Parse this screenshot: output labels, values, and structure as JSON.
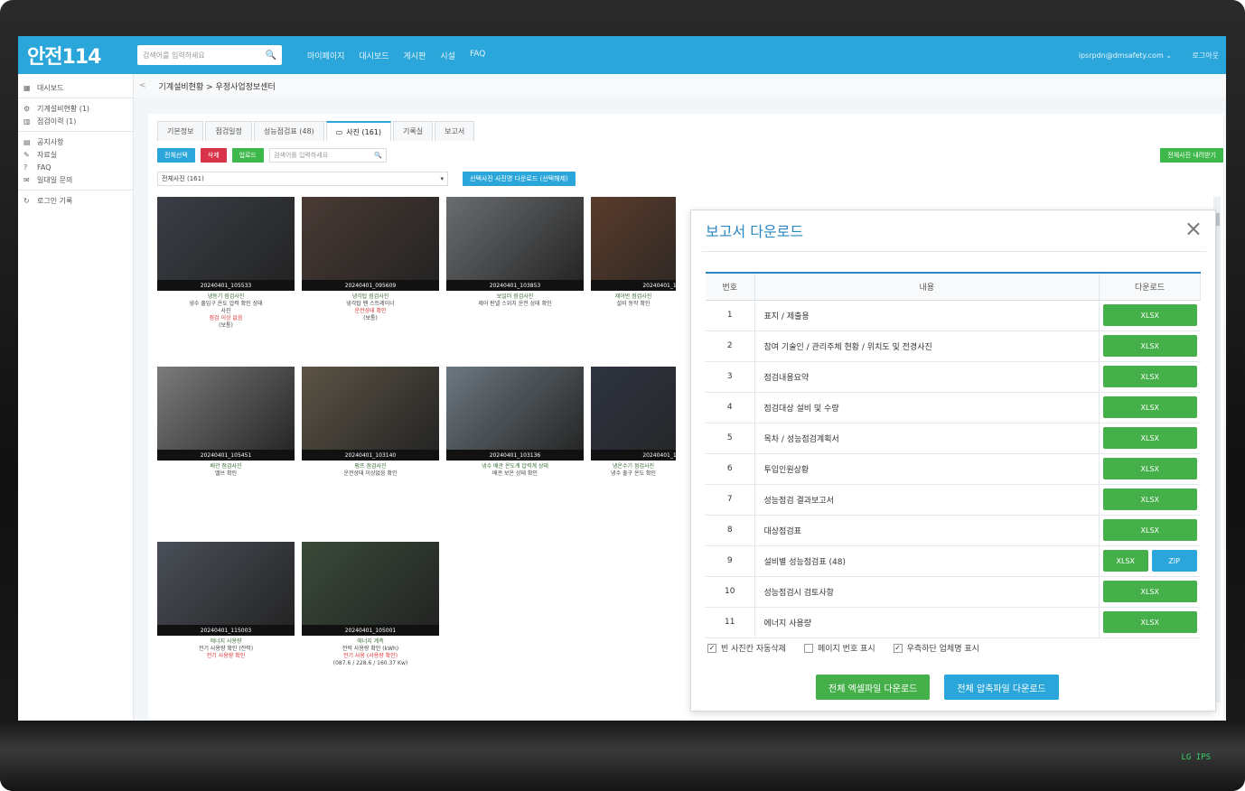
{
  "app": {
    "logo": "안전114",
    "search_placeholder": "검색어를 입력하세요",
    "nav": [
      "마이페이지",
      "대시보드",
      "게시판",
      "시설",
      "FAQ"
    ],
    "user": "ipsrpdn@dmsafety.com",
    "logout": "로그아웃"
  },
  "sidebar": {
    "items": [
      {
        "icon": "grid-icon",
        "label": "대시보드"
      },
      {
        "icon": "gear-icon",
        "label": "기계설비현황 (1)"
      },
      {
        "icon": "building-icon",
        "label": "점검이력 (1)"
      },
      {
        "icon": "doc-icon",
        "label": "공지사항"
      },
      {
        "icon": "pin-icon",
        "label": "자료실"
      },
      {
        "icon": "faq-icon",
        "label": "FAQ"
      },
      {
        "icon": "chat-icon",
        "label": "일대일 문의"
      },
      {
        "icon": "logout-icon",
        "label": "로그인 기록"
      }
    ]
  },
  "breadcrumb": {
    "back": "<",
    "path": "기계설비현황 > 우정사업정보센터"
  },
  "tabs": [
    "기본정보",
    "점검일정",
    "성능점검표 (48)",
    "사진 (161)",
    "기록실",
    "보고서"
  ],
  "active_tab_index": 3,
  "toolbar": {
    "btn1": "전체선택",
    "btn2": "삭제",
    "btn3": "업로드",
    "search_placeholder": "검색어를 입력하세요",
    "excel_all": "전체사진 내려받기"
  },
  "filter": {
    "select_value": "전체사진 (161)",
    "bulk_button": "선택사진 사진명 다운로드 (선택해제)"
  },
  "photos": [
    {
      "caption": "20240401_105533",
      "lines": [
        {
          "t": "냉동기 점검사진",
          "c": "green"
        },
        {
          "t": "냉수 출입구 온도 압력 확인 상태",
          "c": "dark"
        },
        {
          "t": "사진",
          "c": "dark"
        },
        {
          "t": "점검 이상 없음",
          "c": "red"
        },
        {
          "t": "(보통)",
          "c": "dark"
        }
      ]
    },
    {
      "caption": "20240401_095609",
      "lines": [
        {
          "t": "냉각탑 점검사진",
          "c": "green"
        },
        {
          "t": "냉각탑 팬 스트레이너",
          "c": "dark"
        },
        {
          "t": "운전상태 확인",
          "c": "red"
        },
        {
          "t": "(보통)",
          "c": "dark"
        }
      ]
    },
    {
      "caption": "20240401_103853",
      "lines": [
        {
          "t": "보일러 점검사진",
          "c": "green"
        },
        {
          "t": "제어 판넬 스위치 운전 상태 확인",
          "c": "dark"
        }
      ]
    },
    {
      "caption": "20240401_1",
      "lines": [
        {
          "t": "제어반 점검사진",
          "c": "green"
        },
        {
          "t": "설비 동작 확인",
          "c": "dark"
        }
      ]
    },
    {
      "caption": "20240401_105451",
      "lines": [
        {
          "t": "배관 점검사진",
          "c": "green"
        },
        {
          "t": "밸브 확인",
          "c": "dark"
        }
      ]
    },
    {
      "caption": "20240401_103140",
      "lines": [
        {
          "t": "펌프 점검사진",
          "c": "green"
        },
        {
          "t": "운전상태 이상없음 확인",
          "c": "dark"
        }
      ]
    },
    {
      "caption": "20240401_103136",
      "lines": [
        {
          "t": "냉수 배관 온도계 압력계 상태",
          "c": "green"
        },
        {
          "t": "배관 보온 상태 확인",
          "c": "dark"
        }
      ]
    },
    {
      "caption": "20240401_1",
      "lines": [
        {
          "t": "냉온수기 점검사진",
          "c": "green"
        },
        {
          "t": "냉수 출구 온도 확인",
          "c": "dark"
        }
      ]
    },
    {
      "caption": "20240401_115003",
      "lines": [
        {
          "t": "에너지 사용량",
          "c": "green"
        },
        {
          "t": "전기 사용량 확인 (전력)",
          "c": "dark"
        },
        {
          "t": "전기 사용량 확인",
          "c": "red"
        }
      ]
    },
    {
      "caption": "20240401_105001",
      "lines": [
        {
          "t": "에너지 계측",
          "c": "green"
        },
        {
          "t": "전력 사용량 확인 (kWh)",
          "c": "dark"
        },
        {
          "t": "전기 사용 (사용량 확인)",
          "c": "red"
        },
        {
          "t": "(087.6 / 228.6 / 160.37 Kw)",
          "c": "dark"
        }
      ]
    }
  ],
  "modal": {
    "title": "보고서 다운로드",
    "close": "×",
    "headers": {
      "num": "번호",
      "content": "내용",
      "download": "다운로드"
    },
    "rows": [
      {
        "num": "1",
        "text": "표지 / 제출용",
        "buttons": [
          "XLSX"
        ]
      },
      {
        "num": "2",
        "text": "참여 기술인 / 관리주체 현황 / 위치도 및 전경사진",
        "buttons": [
          "XLSX"
        ]
      },
      {
        "num": "3",
        "text": "점검내용요약",
        "buttons": [
          "XLSX"
        ]
      },
      {
        "num": "4",
        "text": "점검대상 설비 및 수량",
        "buttons": [
          "XLSX"
        ]
      },
      {
        "num": "5",
        "text": "목차 / 성능점검계획서",
        "buttons": [
          "XLSX"
        ]
      },
      {
        "num": "6",
        "text": "투입인원상황",
        "buttons": [
          "XLSX"
        ]
      },
      {
        "num": "7",
        "text": "성능점검 결과보고서",
        "buttons": [
          "XLSX"
        ]
      },
      {
        "num": "8",
        "text": "대상점검표",
        "buttons": [
          "XLSX"
        ]
      },
      {
        "num": "9",
        "text": "설비별 성능점검표 (48)",
        "buttons": [
          "XLSX",
          "ZIP"
        ]
      },
      {
        "num": "10",
        "text": "성능점검시 검토사항",
        "buttons": [
          "XLSX"
        ]
      },
      {
        "num": "11",
        "text": "에너지 사용량",
        "buttons": [
          "XLSX"
        ]
      }
    ],
    "options": [
      {
        "label": "빈 사진칸 자동삭제",
        "checked": true
      },
      {
        "label": "페이지 번호 표시",
        "checked": false
      },
      {
        "label": "우측하단 업체명 표시",
        "checked": true
      }
    ],
    "action_excel": "전체 엑셀파일 다운로드",
    "action_zip": "전체 압축파일 다운로드"
  },
  "led": "LG IPS",
  "colors": {
    "brand": "#2aa6da",
    "green": "#45b04a",
    "red": "#d9334a",
    "title": "#2a87bf"
  }
}
